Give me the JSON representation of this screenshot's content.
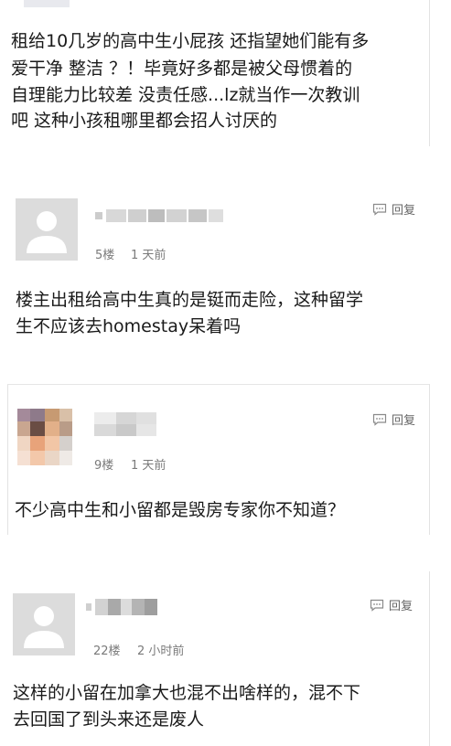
{
  "comments": [
    {
      "lines": [
        "租给10几岁的高中生小屁孩 还指望她们能有多",
        "爱干净 整洁 ？！毕竟好多都是被父母惯着的",
        "自理能力比较差  没责任感...lz就当作一次教训",
        "吧 这种小孩租哪里都会招人讨厌的"
      ]
    },
    {
      "floor": "5楼",
      "time": "1 天前",
      "reply": "回复",
      "lines": [
        "楼主出租给高中生真的是铤而走险，这种留学",
        "生不应该去homestay呆着吗"
      ]
    },
    {
      "floor": "9楼",
      "time": "1 天前",
      "reply": "回复",
      "lines": [
        "不少高中生和小留都是毁房专家你不知道？"
      ]
    },
    {
      "floor": "22楼",
      "time": "2 小时前",
      "reply": "回复",
      "lines": [
        "这样的小留在加拿大也混不出啥样的，混不下",
        "去回国了到头来还是废人"
      ]
    }
  ],
  "icons": {
    "reply": "speech-bubble-icon",
    "avatar": "default-user-avatar"
  },
  "colors": {
    "text": "#1a1a1a",
    "meta": "#7a7a7a",
    "avatar_bg": "#dcdcdc",
    "divider": "#e6e6e6"
  }
}
